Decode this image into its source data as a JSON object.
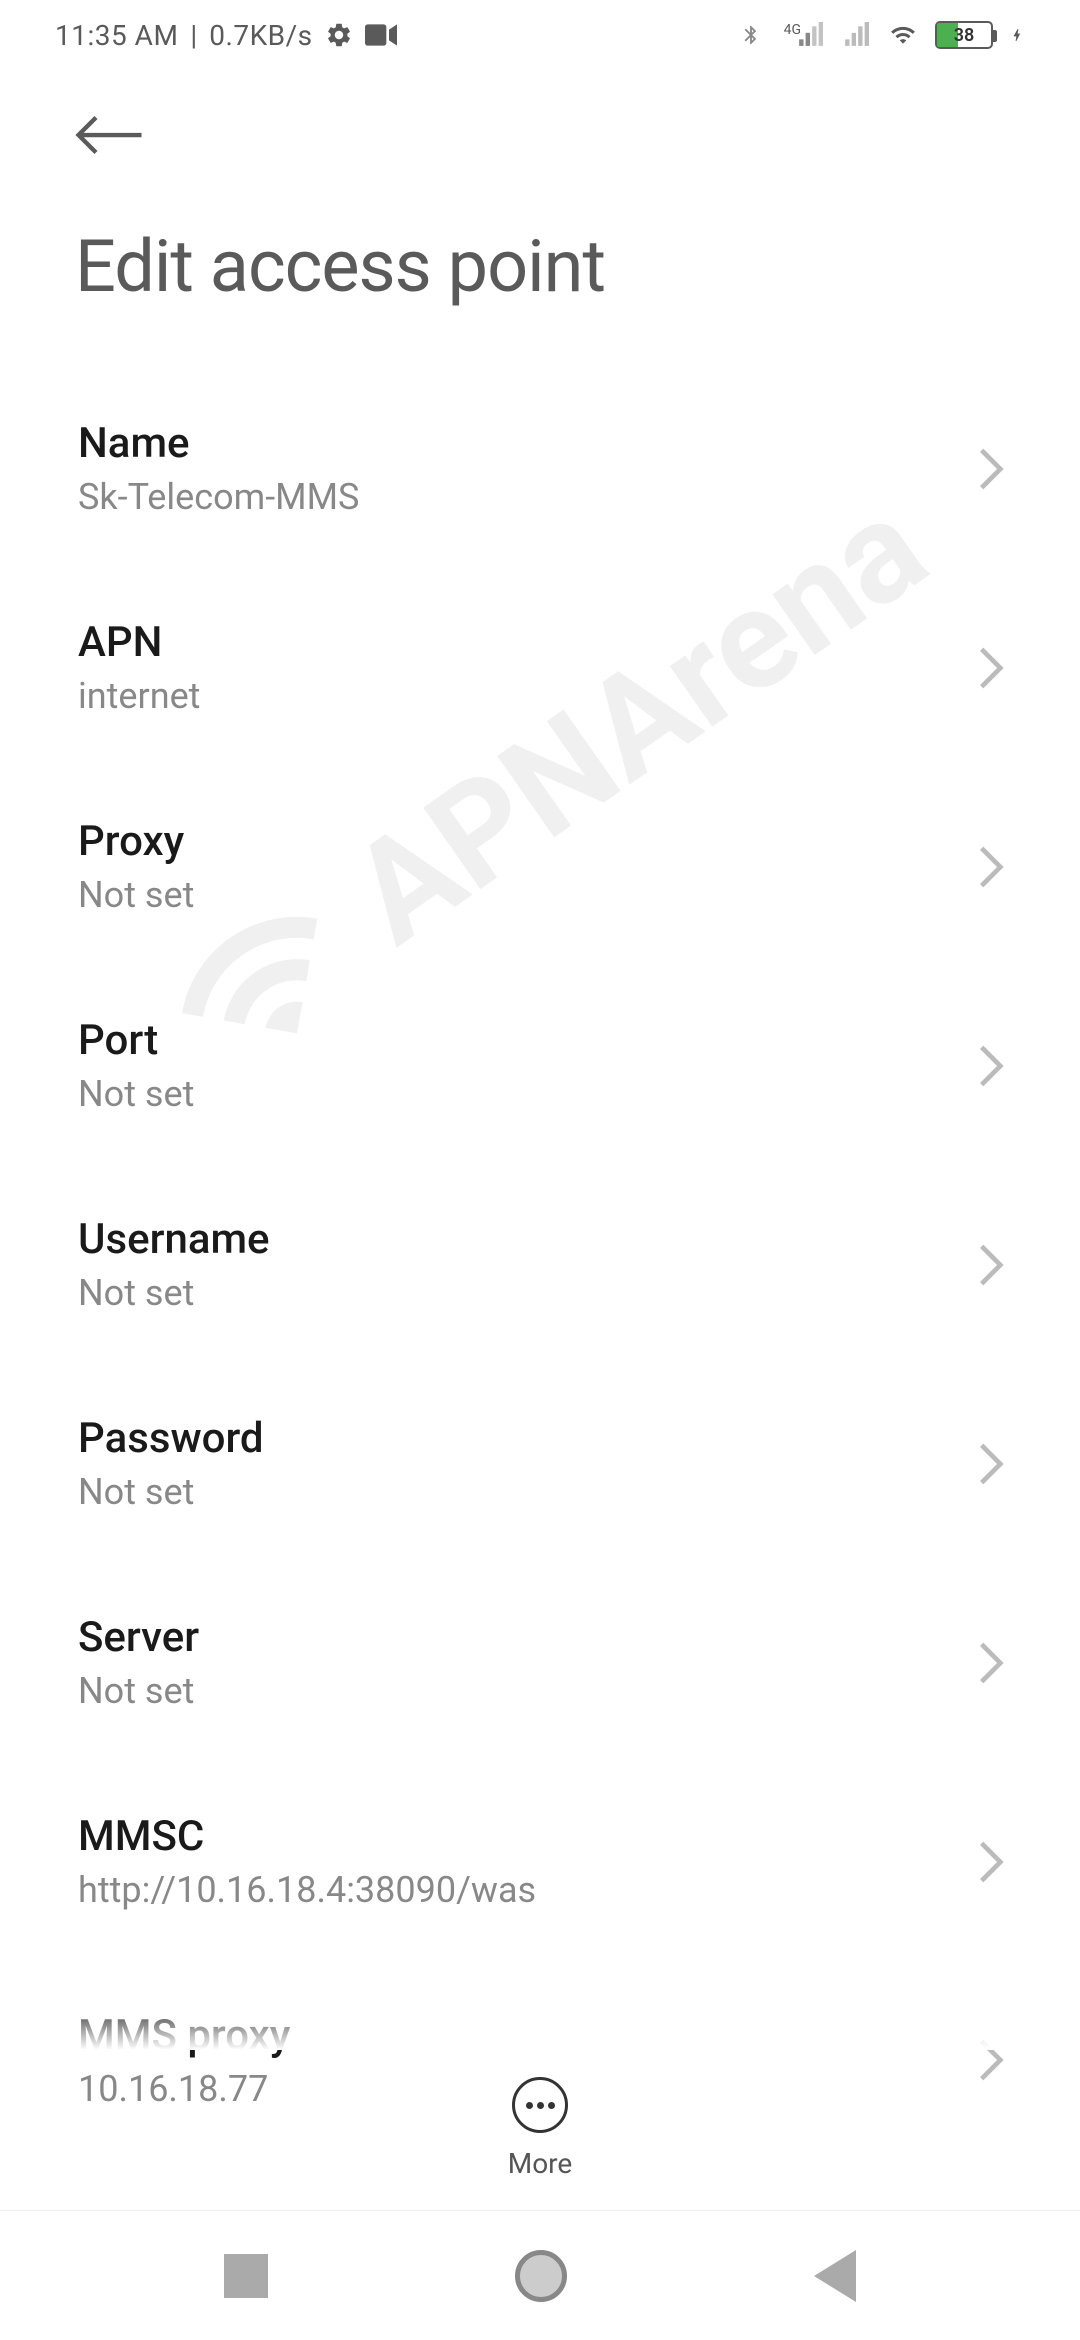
{
  "status_bar": {
    "time": "11:35 AM",
    "speed": "0.7KB/s",
    "battery_pct": "38",
    "network_label": "4G"
  },
  "header": {
    "title": "Edit access point"
  },
  "settings": [
    {
      "label": "Name",
      "value": "Sk-Telecom-MMS"
    },
    {
      "label": "APN",
      "value": "internet"
    },
    {
      "label": "Proxy",
      "value": "Not set"
    },
    {
      "label": "Port",
      "value": "Not set"
    },
    {
      "label": "Username",
      "value": "Not set"
    },
    {
      "label": "Password",
      "value": "Not set"
    },
    {
      "label": "Server",
      "value": "Not set"
    },
    {
      "label": "MMSC",
      "value": "http://10.16.18.4:38090/was"
    },
    {
      "label": "MMS proxy",
      "value": "10.16.18.77"
    }
  ],
  "bottom": {
    "more_label": "More"
  },
  "watermark": {
    "text": "APNArena"
  }
}
